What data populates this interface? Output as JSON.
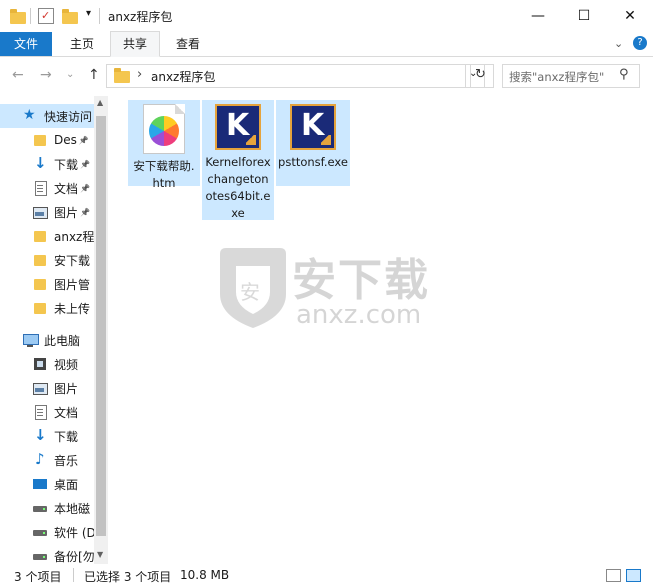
{
  "window": {
    "title": "anxz程序包",
    "minimize_glyph": "—",
    "maximize_glyph": "☐",
    "close_glyph": "✕"
  },
  "ribbon": {
    "tabs": [
      {
        "label": "文件"
      },
      {
        "label": "主页"
      },
      {
        "label": "共享"
      },
      {
        "label": "查看"
      }
    ]
  },
  "address": {
    "path": "anxz程序包",
    "separator": "›"
  },
  "search": {
    "placeholder": "搜索\"anxz程序包\""
  },
  "nav_pane": {
    "items": [
      {
        "label": "快速访问",
        "icon": "star-icon"
      },
      {
        "label": "Des",
        "icon": "folder-icon"
      },
      {
        "label": "下载",
        "icon": "download-icon"
      },
      {
        "label": "文档",
        "icon": "document-icon"
      },
      {
        "label": "图片",
        "icon": "picture-icon"
      },
      {
        "label": "anxz程",
        "icon": "folder-icon"
      },
      {
        "label": "安下载",
        "icon": "folder-icon"
      },
      {
        "label": "图片管",
        "icon": "folder-icon"
      },
      {
        "label": "未上传",
        "icon": "folder-icon"
      },
      {
        "label": "此电脑",
        "icon": "computer-icon"
      },
      {
        "label": "视频",
        "icon": "video-icon"
      },
      {
        "label": "图片",
        "icon": "picture-icon"
      },
      {
        "label": "文档",
        "icon": "document-icon"
      },
      {
        "label": "下载",
        "icon": "download-icon"
      },
      {
        "label": "音乐",
        "icon": "music-icon"
      },
      {
        "label": "桌面",
        "icon": "desktop-icon"
      },
      {
        "label": "本地磁",
        "icon": "drive-icon"
      },
      {
        "label": "软件 (D",
        "icon": "drive-icon"
      },
      {
        "label": "备份[勿",
        "icon": "drive-icon"
      }
    ]
  },
  "files": [
    {
      "name": "安下载帮助.htm",
      "icon": "htm-file-icon"
    },
    {
      "name": "Kernelforexchangetonotes64bit.exe",
      "icon": "kernel-app-icon",
      "icon_letter": "K"
    },
    {
      "name": "psttonsf.exe",
      "icon": "kernel-app-icon",
      "icon_letter": "K"
    }
  ],
  "watermark": {
    "text_cn": "安下载",
    "text_en": "anxz.com",
    "shield_letter": "安"
  },
  "status": {
    "count": "3 个项目",
    "selected": "已选择 3 个项目",
    "size": "10.8 MB"
  },
  "colors": {
    "accent": "#1979ca",
    "selection": "#cce8ff",
    "folder": "#f4c64f"
  }
}
